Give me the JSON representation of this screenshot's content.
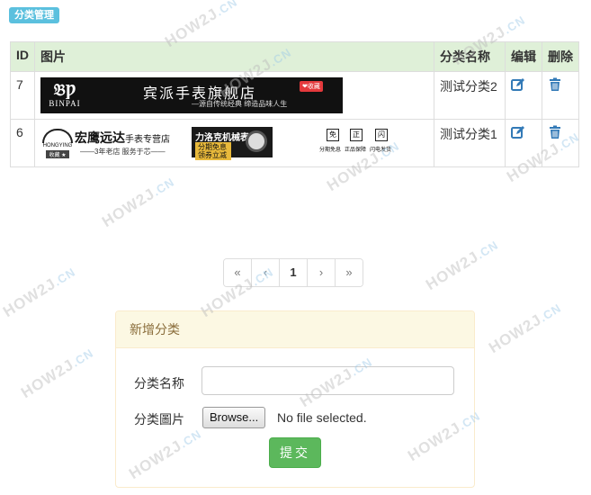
{
  "section_badge": "分类管理",
  "table": {
    "headers": {
      "id": "ID",
      "image": "图片",
      "name": "分类名称",
      "edit": "编辑",
      "delete": "删除"
    },
    "rows": [
      {
        "id": "7",
        "name": "测试分类2",
        "banner": {
          "logo_text": "BINPAI",
          "title": "宾派手表旗舰店",
          "slogan": "—源自传统经典  缔造品味人生",
          "fav": "❤收藏"
        }
      },
      {
        "id": "6",
        "name": "测试分类1",
        "banner": {
          "logo_text": "HONGYING",
          "logo_fav": "收藏 ★",
          "store": "宏鹰远达",
          "store_suffix": "手表专营店",
          "store_sub": "——3年老店 服务于芯——",
          "promo_title": "力洛克机械表",
          "promo_sub": "分期免息 领券立减",
          "badges": [
            {
              "char": "免",
              "caption": "分期免息"
            },
            {
              "char": "正",
              "caption": "正品保障"
            },
            {
              "char": "闪",
              "caption": "闪电发货"
            }
          ]
        }
      }
    ]
  },
  "pagination": {
    "first": "«",
    "prev": "‹",
    "current": "1",
    "next": "›",
    "last": "»"
  },
  "form": {
    "heading": "新增分类",
    "name_label": "分类名称",
    "name_value": "",
    "image_label": "分类圖片",
    "browse_label": "Browse...",
    "file_status": "No file selected.",
    "submit_label": "提交"
  },
  "watermark": {
    "text": "HOW2J",
    "suffix": ".CN"
  },
  "colors": {
    "badge": "#5bc0de",
    "header_row": "#dff0d8",
    "link": "#337ab7",
    "submit": "#5cb85c",
    "panel_heading": "#fcf8e3"
  },
  "icons": {
    "edit": "edit-icon",
    "delete": "trash-icon"
  }
}
